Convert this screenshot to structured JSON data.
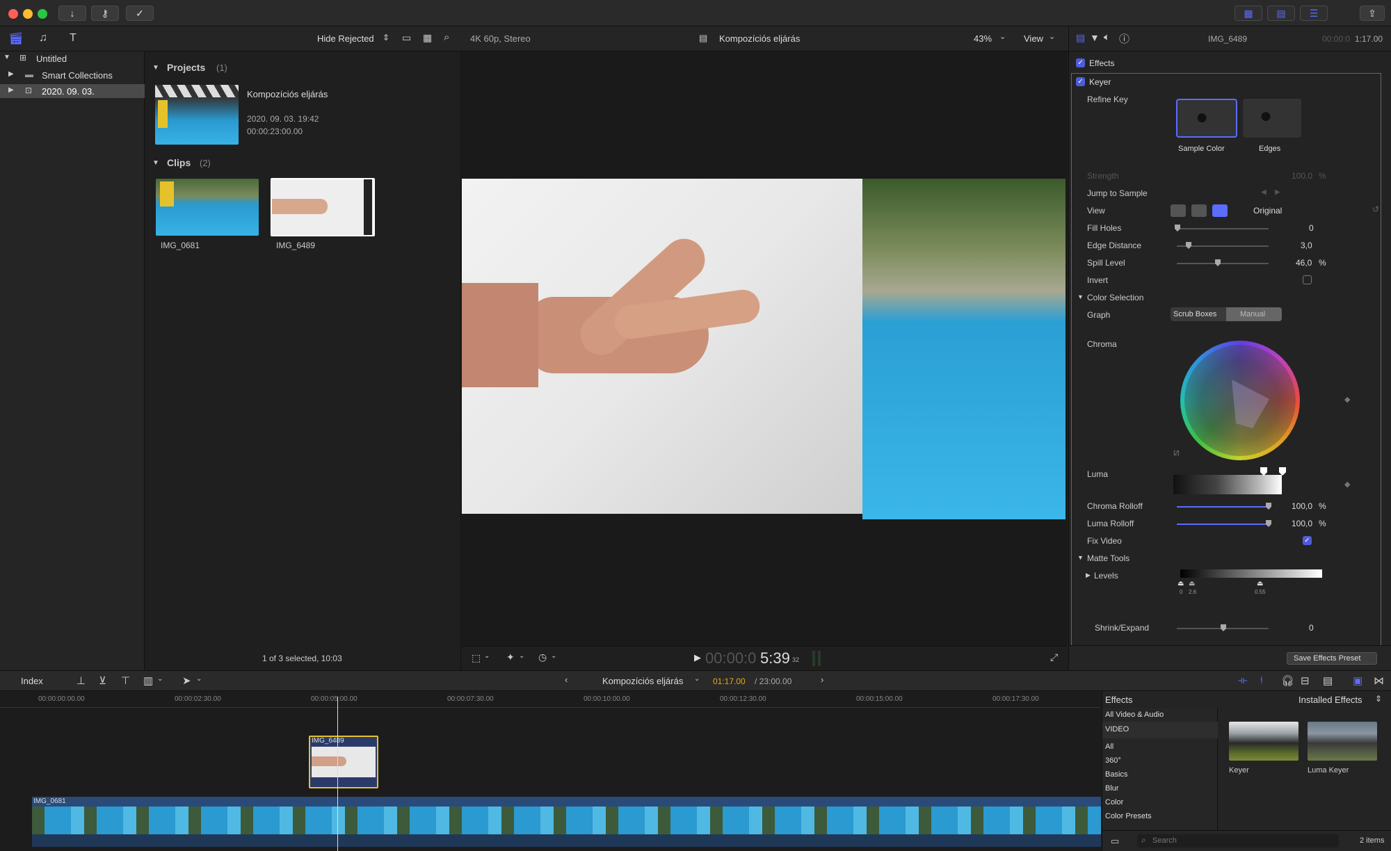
{
  "library": {
    "root": "Untitled",
    "items": [
      "Smart Collections",
      "2020. 09. 03."
    ]
  },
  "browser": {
    "filter": "Hide Rejected",
    "projects_header": "Projects",
    "projects_count": "(1)",
    "project": {
      "name": "Kompozíciós eljárás",
      "date": "2020. 09. 03. 19:42",
      "duration": "00:00:23:00.00"
    },
    "clips_header": "Clips",
    "clips_count": "(2)",
    "clips": [
      "IMG_0681",
      "IMG_6489"
    ],
    "status": "1 of 3 selected, 10:03"
  },
  "viewer": {
    "format": "4K 60p, Stereo",
    "title": "Kompozíciós eljárás",
    "zoom": "43%",
    "view": "View",
    "tc_dim": "00:00:0",
    "tc_main": "5:39",
    "tc_frames": "32"
  },
  "inspector": {
    "clip": "IMG_6489",
    "timecode_dim": "00:00:0",
    "timecode": "1:17.00",
    "effects_label": "Effects",
    "keyer_label": "Keyer",
    "refine_key": "Refine Key",
    "sample_color": "Sample Color",
    "edges": "Edges",
    "strength": "Strength",
    "strength_val": "100,0",
    "pct": "%",
    "jump": "Jump to Sample",
    "view": "View",
    "view_val": "Original",
    "fill_holes": "Fill Holes",
    "fill_holes_val": "0",
    "edge_distance": "Edge Distance",
    "edge_distance_val": "3,0",
    "spill_level": "Spill Level",
    "spill_level_val": "46,0",
    "invert": "Invert",
    "color_selection": "Color Selection",
    "graph": "Graph",
    "scrub": "Scrub Boxes",
    "manual": "Manual",
    "chroma": "Chroma",
    "luma": "Luma",
    "chroma_rolloff": "Chroma Rolloff",
    "chroma_rolloff_val": "100,0",
    "luma_rolloff": "Luma Rolloff",
    "luma_rolloff_val": "100,0",
    "fix_video": "Fix Video",
    "matte_tools": "Matte Tools",
    "levels": "Levels",
    "levels_marks": [
      "0",
      "2.6",
      "0.55"
    ],
    "shrink": "Shrink/Expand",
    "shrink_val": "0",
    "save_preset": "Save Effects Preset"
  },
  "timelinebar": {
    "index": "Index",
    "project": "Kompozíciós eljárás",
    "tc_current": "01:17.00",
    "tc_total": "/ 23:00.00"
  },
  "ruler": [
    "00:00:00:00.00",
    "00:00:02:30.00",
    "00:00:05:00.00",
    "00:00:07:30.00",
    "00:00:10:00.00",
    "00:00:12:30.00",
    "00:00:15:00.00",
    "00:00:17:30.00"
  ],
  "timeline": {
    "connected_clip": "IMG_6489",
    "primary_clip": "IMG_0681"
  },
  "effects": {
    "title": "Effects",
    "installed": "Installed Effects",
    "categories": [
      "All Video & Audio",
      "VIDEO",
      "All",
      "360°",
      "Basics",
      "Blur",
      "Color",
      "Color Presets"
    ],
    "items": [
      "Keyer",
      "Luma Keyer"
    ],
    "search_placeholder": "Search",
    "count": "2 items"
  }
}
